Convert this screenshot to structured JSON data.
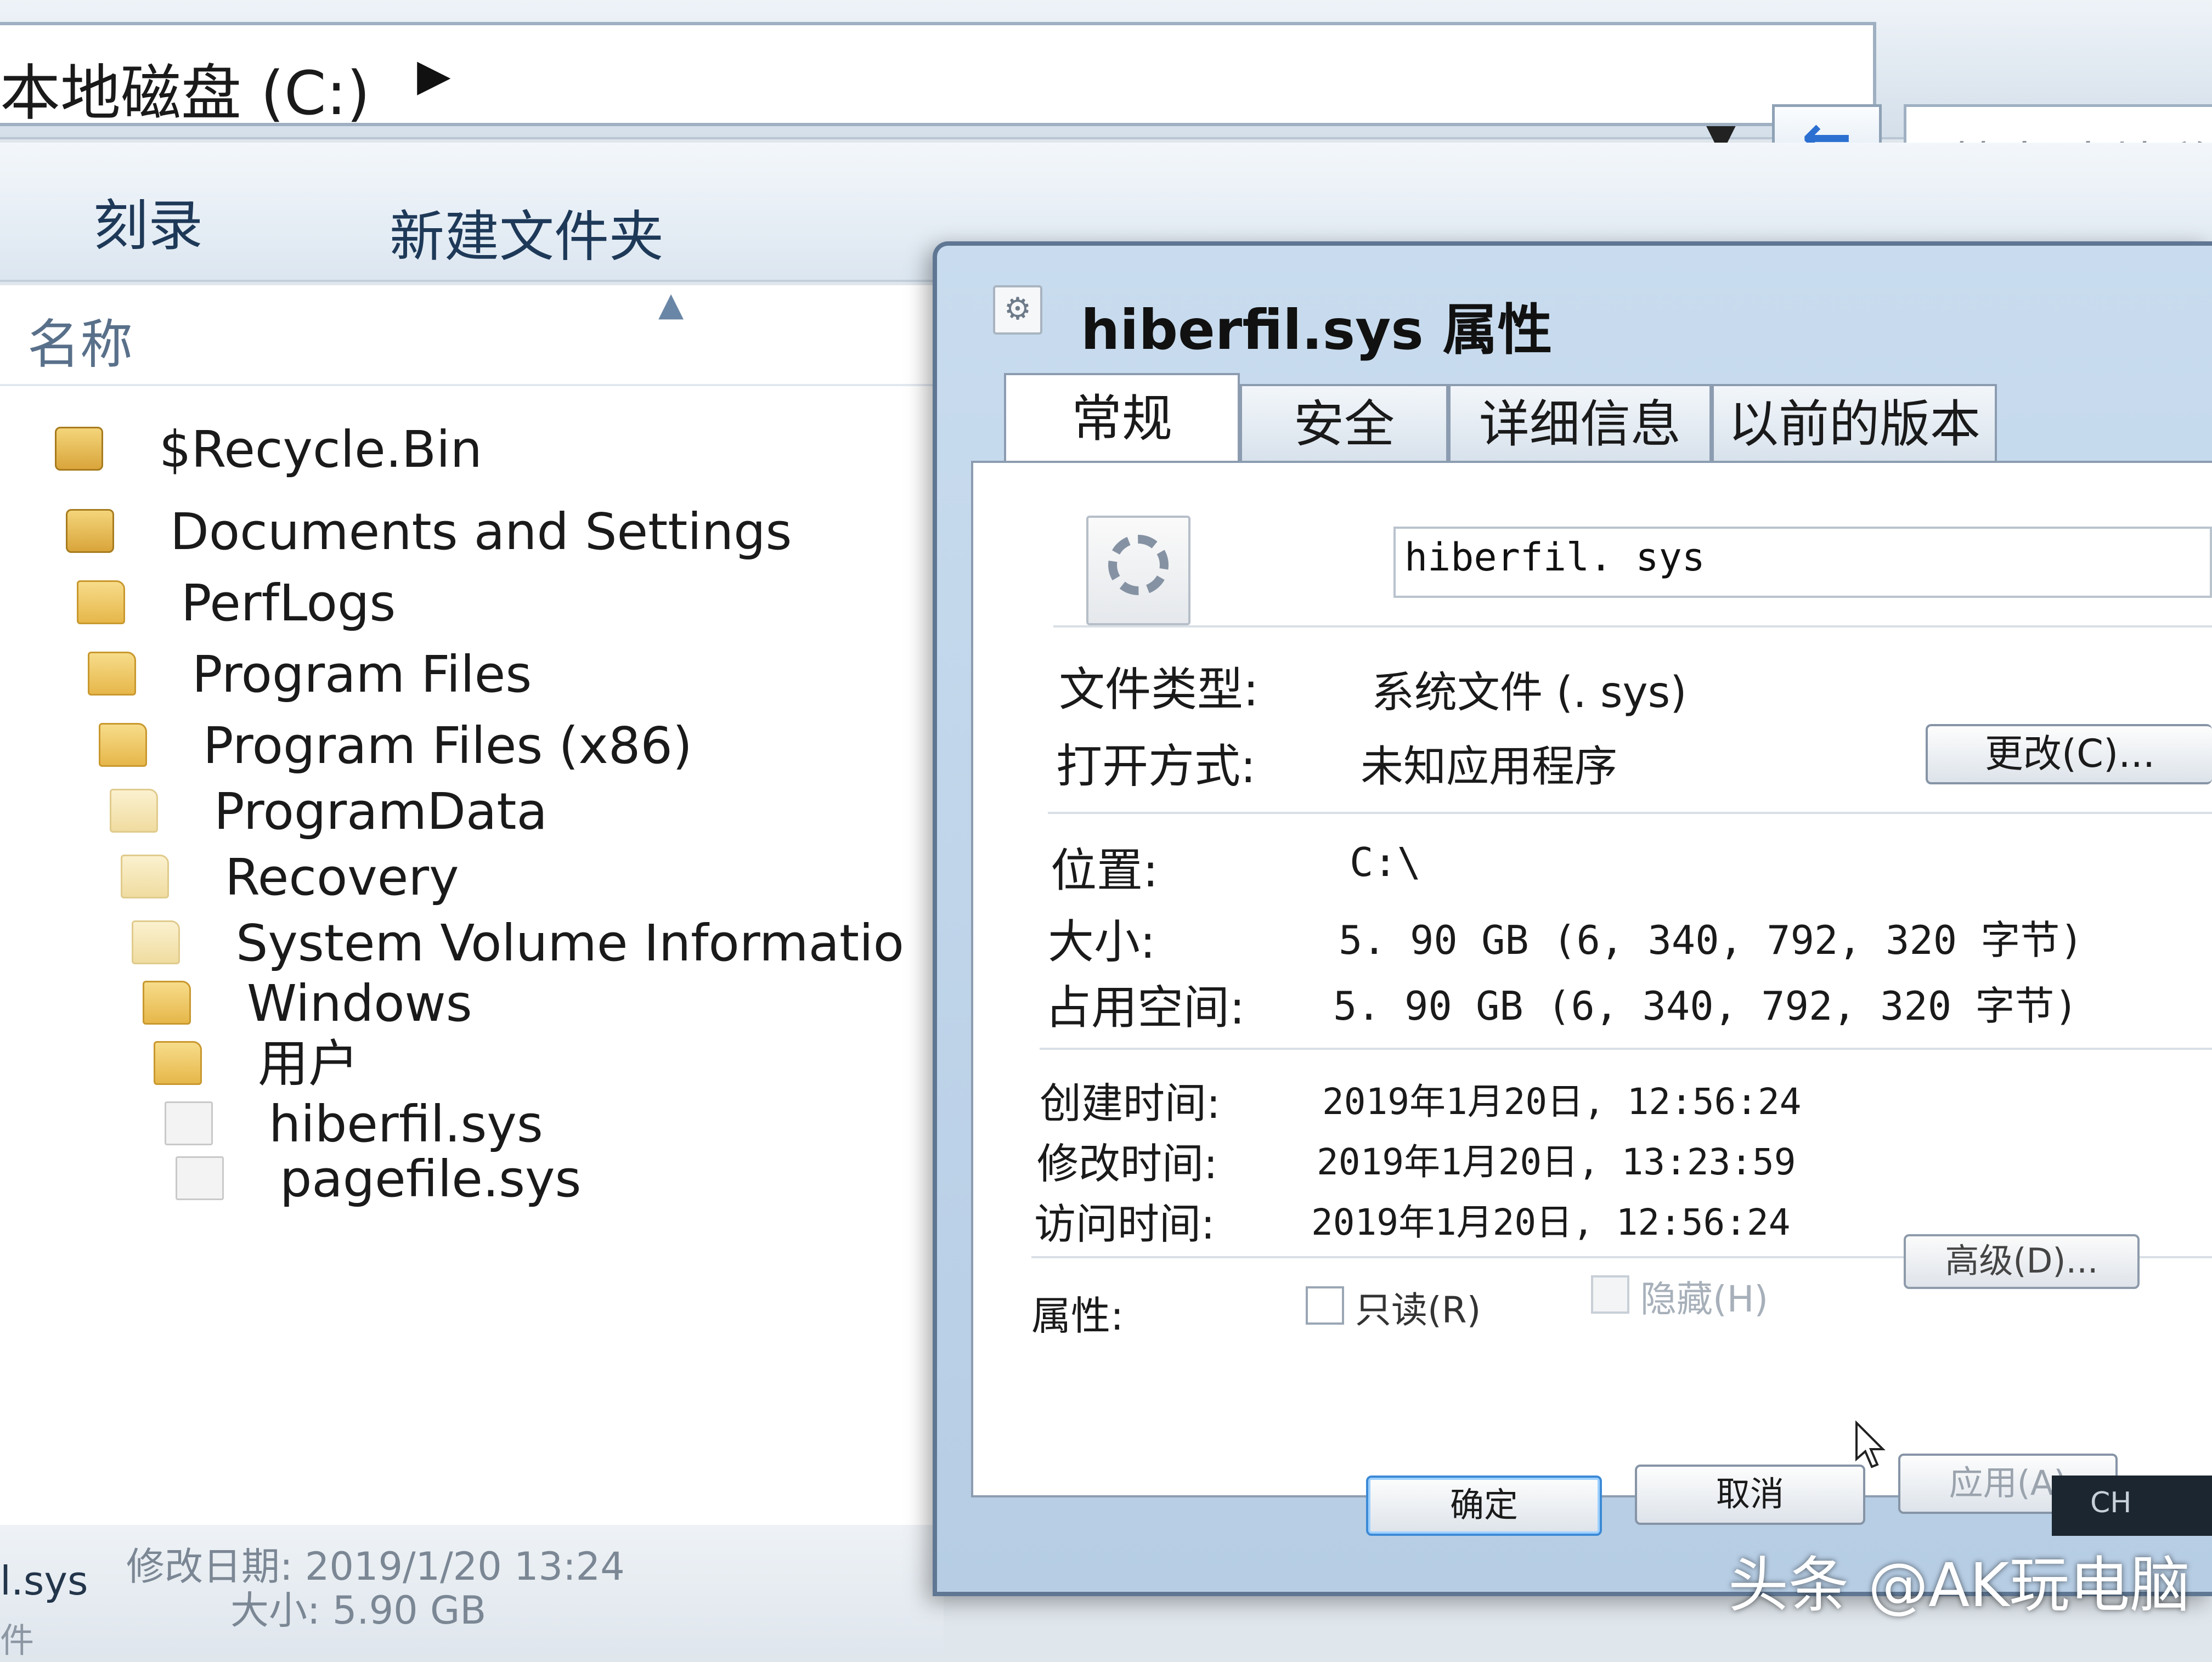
{
  "explorer": {
    "address_path": "本地磁盘 (C:)",
    "search_placeholder": "搜索 本地磁",
    "toolbar": {
      "burn": "刻录",
      "new_folder": "新建文件夹"
    },
    "column_name": "名称",
    "files": [
      {
        "name": "$Recycle.Bin",
        "icon": "lock-folder-icon"
      },
      {
        "name": "Documents and Settings",
        "icon": "lock-folder-icon"
      },
      {
        "name": "PerfLogs",
        "icon": "folder-icon"
      },
      {
        "name": "Program Files",
        "icon": "folder-icon"
      },
      {
        "name": "Program Files (x86)",
        "icon": "folder-icon"
      },
      {
        "name": "ProgramData",
        "icon": "pale-folder-icon"
      },
      {
        "name": "Recovery",
        "icon": "pale-folder-icon"
      },
      {
        "name": "System Volume Informatio",
        "icon": "pale-folder-icon"
      },
      {
        "name": "Windows",
        "icon": "folder-icon"
      },
      {
        "name": "用户",
        "icon": "folder-icon"
      },
      {
        "name": "hiberfil.sys",
        "icon": "system-file-icon"
      },
      {
        "name": "pagefile.sys",
        "icon": "system-file-icon"
      }
    ],
    "status": {
      "name": "l.sys",
      "modified": "修改日期: 2019/1/20 13:24",
      "size": "大小: 5.90 GB",
      "type": "件"
    }
  },
  "dialog": {
    "title": "hiberfil.sys 属性",
    "tabs": [
      "常规",
      "安全",
      "详细信息",
      "以前的版本"
    ],
    "filename": "hiberfil. sys",
    "file_type_label": "文件类型:",
    "file_type_value": "系统文件 (. sys)",
    "open_with_label": "打开方式:",
    "open_with_value": "未知应用程序",
    "change_button": "更改(C)...",
    "location_label": "位置:",
    "location_value": "C:\\",
    "size_label": "大小:",
    "size_value": "5. 90 GB (6, 340, 792, 320 字节)",
    "disk_size_label": "占用空间:",
    "disk_size_value": "5. 90 GB (6, 340, 792, 320 字节)",
    "created_label": "创建时间:",
    "created_value": "2019年1月20日, 12:56:24",
    "modified_label": "修改时间:",
    "modified_value": "2019年1月20日, 13:23:59",
    "accessed_label": "访问时间:",
    "accessed_value": "2019年1月20日, 12:56:24",
    "attributes_label": "属性:",
    "readonly_label": "只读(R)",
    "hidden_label": "隐藏(H)",
    "advanced_button": "高级(D)...",
    "ok_button": "确定",
    "cancel_button": "取消",
    "apply_button": "应用(A)"
  },
  "tray": {
    "lang": "CH"
  },
  "watermark": "头条 @AK玩电脑"
}
